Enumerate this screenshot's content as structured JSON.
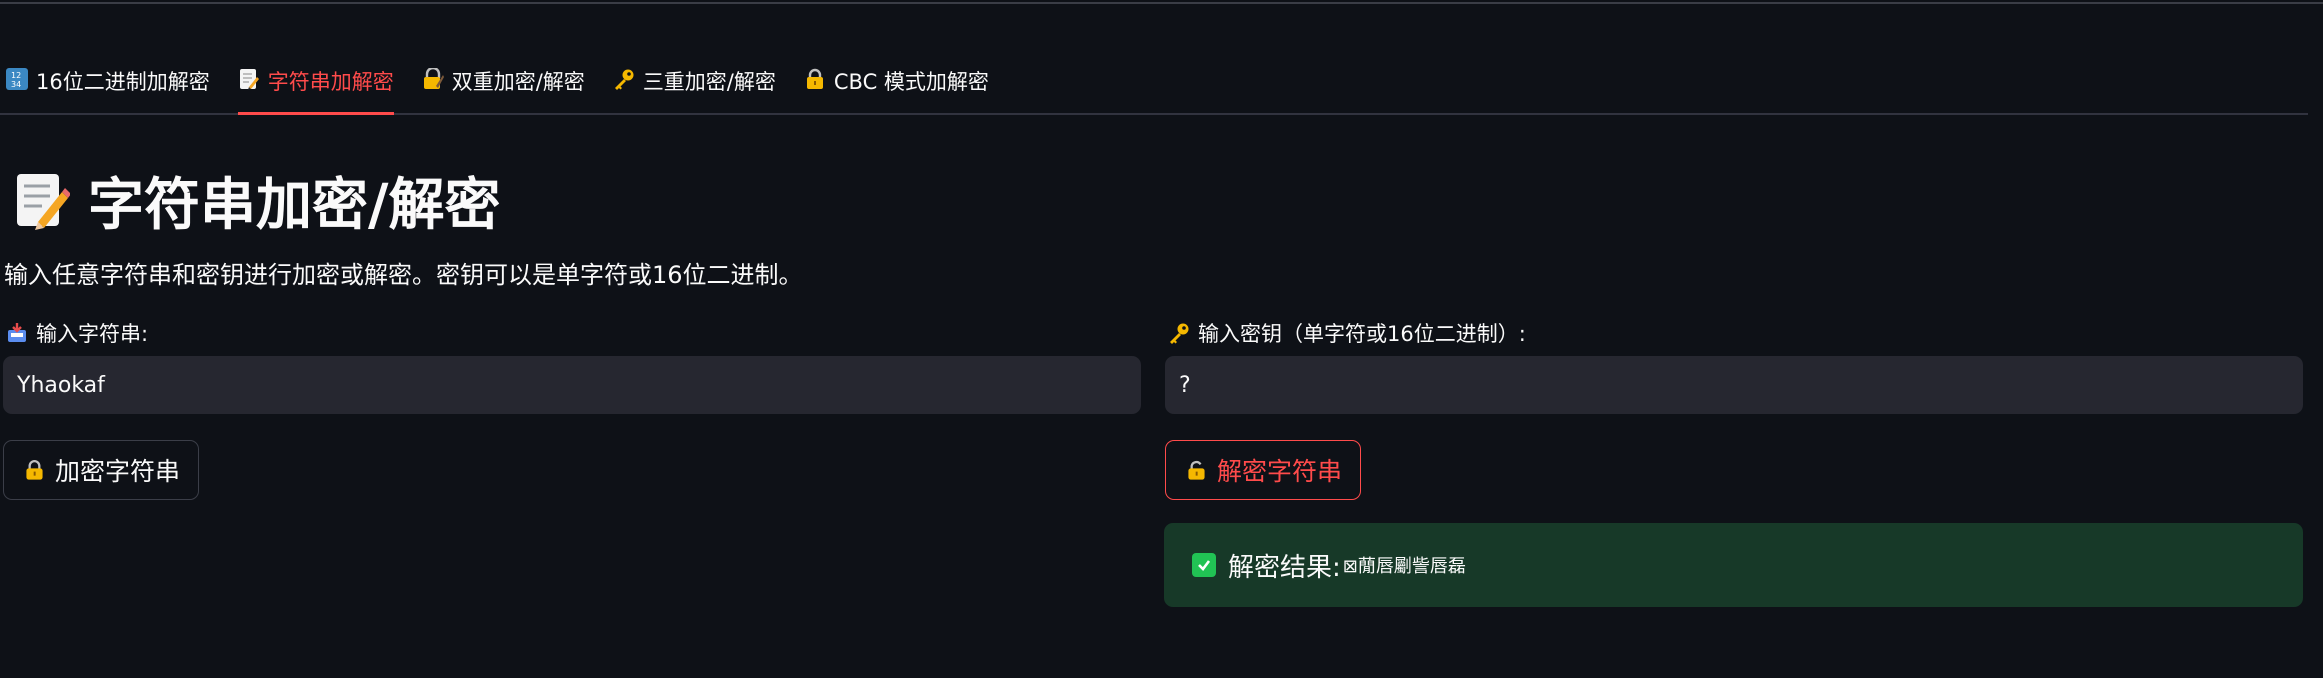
{
  "tabs": [
    {
      "label": "16位二进制加解密",
      "icon": "input-numbers-icon",
      "active": false
    },
    {
      "label": "字符串加解密",
      "icon": "memo-icon",
      "active": true
    },
    {
      "label": "双重加密/解密",
      "icon": "lock-with-pen-icon",
      "active": false
    },
    {
      "label": "三重加密/解密",
      "icon": "key-icon",
      "active": false
    },
    {
      "label": "CBC 模式加解密",
      "icon": "lock-icon",
      "active": false
    }
  ],
  "page": {
    "title": "字符串加密/解密",
    "title_icon": "memo-icon",
    "description": "输入任意字符串和密钥进行加密或解密。密钥可以是单字符或16位二进制。"
  },
  "string_input": {
    "label": "输入字符串:",
    "icon": "inbox-tray-icon",
    "value": "Yhaokaf"
  },
  "key_input": {
    "label": "输入密钥（单字符或16位二进制）:",
    "icon": "key-icon",
    "value": "?"
  },
  "buttons": {
    "encrypt_label": "加密字符串",
    "decrypt_label": "解密字符串"
  },
  "result": {
    "label": "解密结果:",
    "value": "⊠蕑唇劚訾唇磊"
  },
  "colors": {
    "background": "#0e1117",
    "accent": "#ff4b4b",
    "input_bg": "#262730",
    "success_bg": "#173928",
    "success_check": "#21c354"
  }
}
